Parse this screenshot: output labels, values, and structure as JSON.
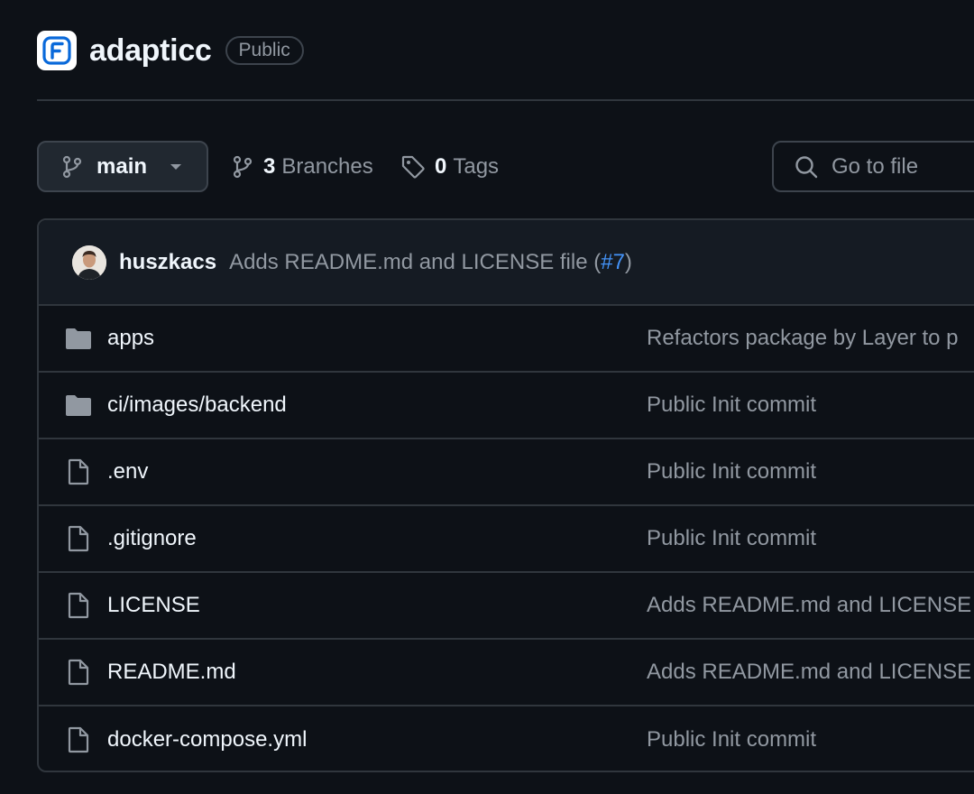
{
  "repo": {
    "name": "adapticc",
    "visibility": "Public",
    "logo_icon": "repo-logo-icon",
    "logo_color": "#0969da"
  },
  "toolbar": {
    "branch_label": "main",
    "branches_count": "3",
    "branches_label": "Branches",
    "tags_count": "0",
    "tags_label": "Tags",
    "goto_file_placeholder": "Go to file"
  },
  "latest_commit": {
    "author": "huszkacs",
    "message_prefix": "Adds README.md and LICENSE file (",
    "pr_link": "#7",
    "message_suffix": ")"
  },
  "files": [
    {
      "name": "apps",
      "type": "folder",
      "icon": "folder-icon",
      "last_commit": "Refactors package by Layer to p"
    },
    {
      "name": "ci/images/backend",
      "type": "folder",
      "icon": "folder-icon",
      "last_commit": "Public Init commit"
    },
    {
      "name": ".env",
      "type": "file",
      "icon": "file-icon",
      "last_commit": "Public Init commit"
    },
    {
      "name": ".gitignore",
      "type": "file",
      "icon": "file-icon",
      "last_commit": "Public Init commit"
    },
    {
      "name": "LICENSE",
      "type": "file",
      "icon": "file-icon",
      "last_commit": "Adds README.md and LICENSE"
    },
    {
      "name": "README.md",
      "type": "file",
      "icon": "file-icon",
      "last_commit": "Adds README.md and LICENSE"
    },
    {
      "name": "docker-compose.yml",
      "type": "file",
      "icon": "file-icon",
      "last_commit": "Public Init commit"
    }
  ],
  "colors": {
    "background": "#0d1117",
    "border": "#30363d",
    "muted_text": "#9198a1",
    "primary_text": "#f0f6fc",
    "link": "#4493f8",
    "folder": "#9198a1"
  }
}
